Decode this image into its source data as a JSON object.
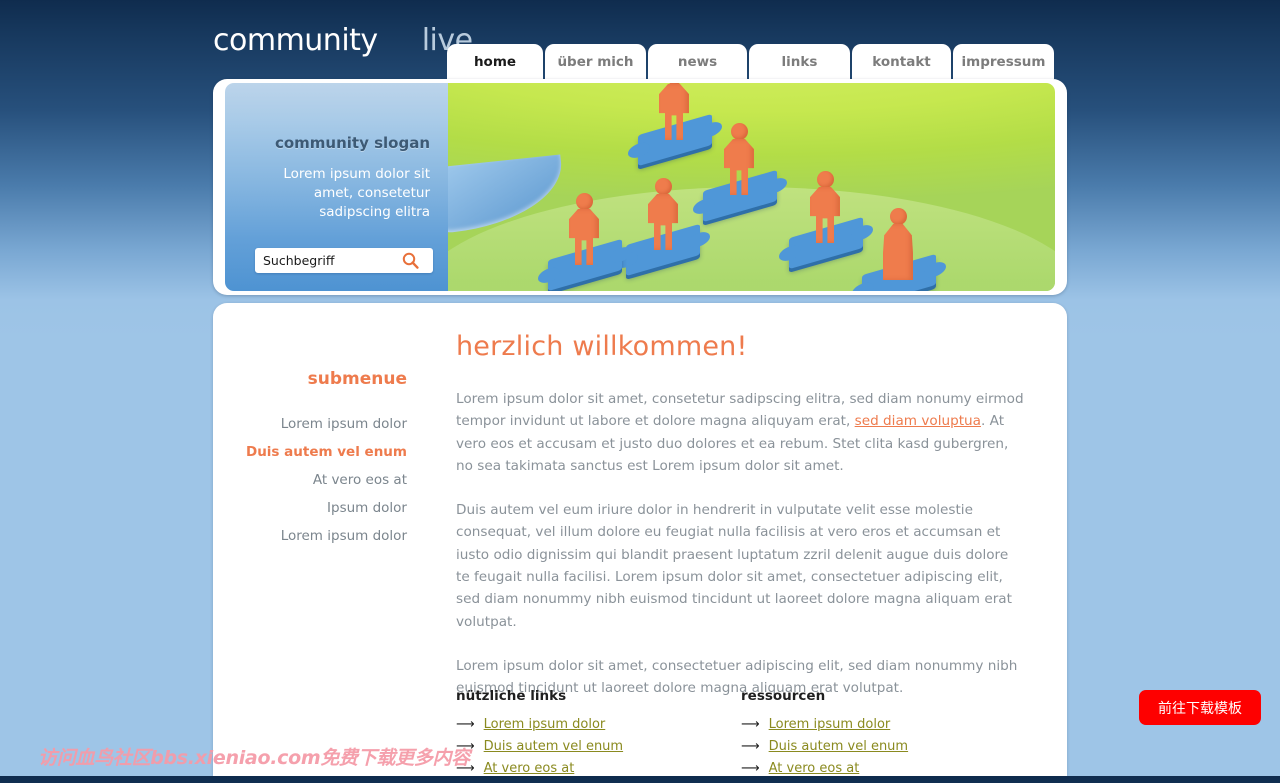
{
  "site": {
    "logo_primary": "community",
    "logo_secondary": "live",
    "logo_icon_female": "female-figure-icon",
    "logo_icon_male": "male-figure-icon"
  },
  "nav": {
    "tabs": [
      {
        "label": "home",
        "active": true
      },
      {
        "label": "über mich",
        "active": false
      },
      {
        "label": "news",
        "active": false
      },
      {
        "label": "links",
        "active": false
      },
      {
        "label": "kontakt",
        "active": false
      },
      {
        "label": "impressum",
        "active": false
      }
    ]
  },
  "hero": {
    "slogan_title": "community slogan",
    "slogan_text": "Lorem ipsum dolor sit amet, consetetur sadipscing elitra",
    "search": {
      "value": "Suchbegriff",
      "placeholder": "Suchbegriff",
      "button_icon": "search-icon"
    },
    "illustration_alt": "orange people standing on blue puzzle pieces"
  },
  "submenu": {
    "title": "submenue",
    "items": [
      {
        "label": "Lorem ipsum dolor",
        "active": false
      },
      {
        "label": "Duis autem vel enum",
        "active": true
      },
      {
        "label": "At vero eos at",
        "active": false
      },
      {
        "label": "Ipsum dolor",
        "active": false
      },
      {
        "label": "Lorem ipsum dolor",
        "active": false
      }
    ]
  },
  "main": {
    "heading": "herzlich willkommen!",
    "p1_before": "Lorem ipsum dolor sit amet, consetetur sadipscing elitra, sed diam nonumy eirmod tempor invidunt ut labore et dolore magna aliquyam erat, ",
    "p1_link": "sed diam voluptua",
    "p1_after": ". At vero eos et accusam et justo duo dolores et ea rebum. Stet clita kasd gubergren, no sea takimata sanctus est Lorem ipsum dolor sit amet.",
    "p2": "Duis autem vel eum iriure dolor in hendrerit in vulputate velit esse molestie consequat, vel illum dolore eu feugiat nulla facilisis at vero eros et accumsan et iusto odio dignissim qui blandit praesent luptatum zzril delenit augue duis dolore te feugait nulla facilisi. Lorem ipsum dolor sit amet, consectetuer adipiscing elit, sed diam nonummy nibh euismod tincidunt ut laoreet dolore magna aliquam erat volutpat.",
    "p3": "Lorem ipsum dolor sit amet, consectetuer adipiscing elit, sed diam nonummy nibh euismod tincidunt ut laoreet dolore magna aliquam erat volutpat."
  },
  "link_columns": [
    {
      "title": "nützliche links",
      "links": [
        "Lorem ipsum dolor",
        "Duis autem vel enum",
        "At vero eos at"
      ]
    },
    {
      "title": "ressourcen",
      "links": [
        "Lorem ipsum dolor",
        "Duis autem vel enum",
        "At vero eos at"
      ]
    }
  ],
  "overlay": {
    "watermark": "访问血鸟社区bbs.xieniao.com免费下载更多内容",
    "download_button": "前往下载模板"
  },
  "colors": {
    "accent_orange": "#ee7b4d",
    "logo_green": "#b5e61d",
    "link_olive": "#8a8a1f",
    "bg_dark_navy": "#0f2c4e",
    "bg_light_blue": "#9ec5e7",
    "hero_green": "#c6e84f",
    "puzzle_blue": "#4f97d8",
    "download_red": "#fe0000",
    "watermark_pink": "#f59ba8"
  }
}
